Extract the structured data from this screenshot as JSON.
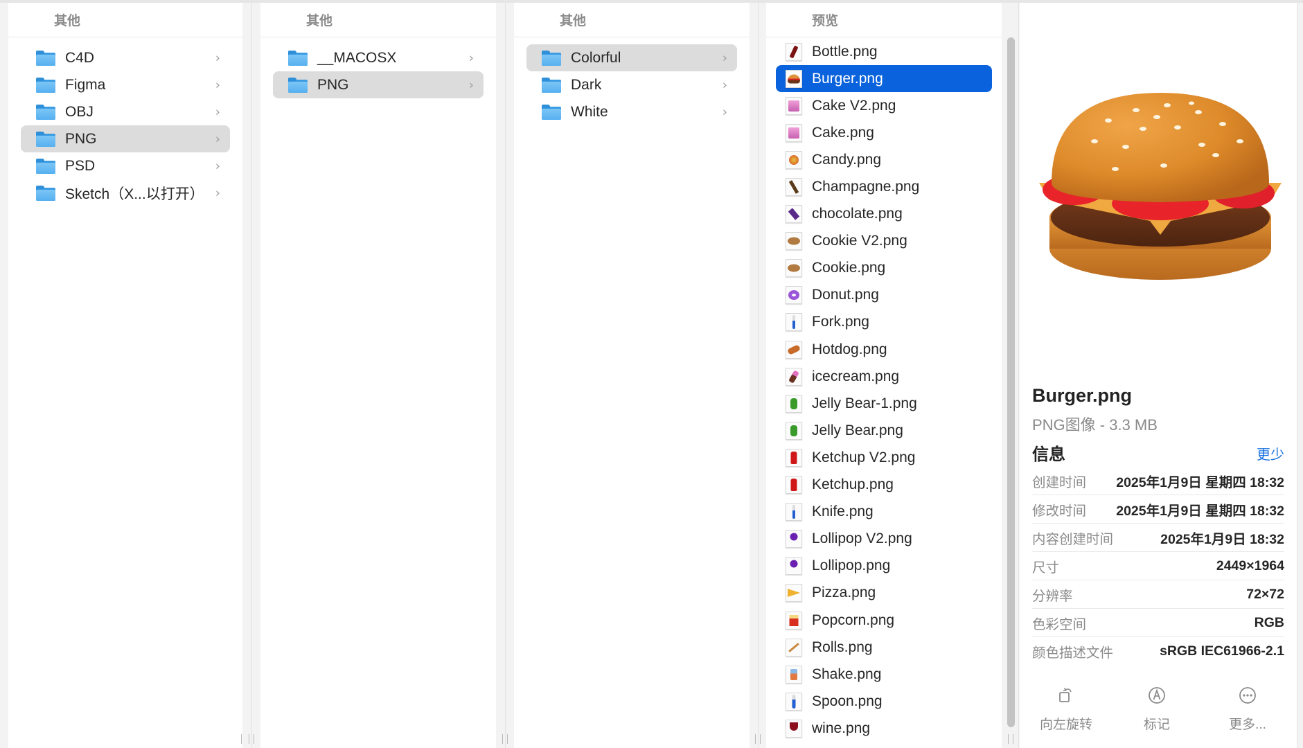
{
  "columns": [
    {
      "header": "其他",
      "items": [
        {
          "label": "C4D",
          "selected": false
        },
        {
          "label": "Figma",
          "selected": false
        },
        {
          "label": "OBJ",
          "selected": false
        },
        {
          "label": "PNG",
          "selected": true
        },
        {
          "label": "PSD",
          "selected": false
        },
        {
          "label": "Sketch（X...以打开）",
          "selected": false
        }
      ]
    },
    {
      "header": "其他",
      "items": [
        {
          "label": "__MACOSX",
          "selected": false
        },
        {
          "label": "PNG",
          "selected": true
        }
      ]
    },
    {
      "header": "其他",
      "items": [
        {
          "label": "Colorful",
          "selected": true
        },
        {
          "label": "Dark",
          "selected": false
        },
        {
          "label": "White",
          "selected": false
        }
      ]
    }
  ],
  "files": {
    "header": "预览",
    "selected_index": 1,
    "items": [
      {
        "name": "Bottle.png",
        "icon": "bottle-icon"
      },
      {
        "name": "Burger.png",
        "icon": "burger-icon"
      },
      {
        "name": "Cake V2.png",
        "icon": "cake-icon"
      },
      {
        "name": "Cake.png",
        "icon": "cake-icon"
      },
      {
        "name": "Candy.png",
        "icon": "candy-icon"
      },
      {
        "name": "Champagne.png",
        "icon": "champagne-icon"
      },
      {
        "name": "chocolate.png",
        "icon": "chocolate-icon"
      },
      {
        "name": "Cookie V2.png",
        "icon": "cookie-icon"
      },
      {
        "name": "Cookie.png",
        "icon": "cookie-icon"
      },
      {
        "name": "Donut.png",
        "icon": "donut-icon"
      },
      {
        "name": "Fork.png",
        "icon": "fork-icon"
      },
      {
        "name": "Hotdog.png",
        "icon": "hotdog-icon"
      },
      {
        "name": "icecream.png",
        "icon": "icecream-icon"
      },
      {
        "name": "Jelly Bear-1.png",
        "icon": "jelly-bear-icon"
      },
      {
        "name": "Jelly Bear.png",
        "icon": "jelly-bear-icon"
      },
      {
        "name": "Ketchup V2.png",
        "icon": "ketchup-icon"
      },
      {
        "name": "Ketchup.png",
        "icon": "ketchup-icon"
      },
      {
        "name": "Knife.png",
        "icon": "knife-icon"
      },
      {
        "name": "Lollipop V2.png",
        "icon": "lollipop-icon"
      },
      {
        "name": "Lollipop.png",
        "icon": "lollipop-icon"
      },
      {
        "name": "Pizza.png",
        "icon": "pizza-icon"
      },
      {
        "name": "Popcorn.png",
        "icon": "popcorn-icon"
      },
      {
        "name": "Rolls.png",
        "icon": "rolls-icon"
      },
      {
        "name": "Shake.png",
        "icon": "shake-icon"
      },
      {
        "name": "Spoon.png",
        "icon": "spoon-icon"
      },
      {
        "name": "wine.png",
        "icon": "wine-icon"
      }
    ]
  },
  "preview": {
    "title": "Burger.png",
    "subtitle": "PNG图像 - 3.3 MB",
    "info_label": "信息",
    "less_label": "更少",
    "metadata": [
      {
        "key": "创建时间",
        "value": "2025年1月9日 星期四 18:32"
      },
      {
        "key": "修改时间",
        "value": "2025年1月9日 星期四 18:32"
      },
      {
        "key": "内容创建时间",
        "value": "2025年1月9日 18:32"
      },
      {
        "key": "尺寸",
        "value": "2449×1964"
      },
      {
        "key": "分辨率",
        "value": "72×72"
      },
      {
        "key": "色彩空间",
        "value": "RGB"
      },
      {
        "key": "颜色描述文件",
        "value": "sRGB IEC61966-2.1"
      }
    ],
    "actions": [
      {
        "label": "向左旋转",
        "icon": "rotate-left-icon"
      },
      {
        "label": "标记",
        "icon": "markup-icon"
      },
      {
        "label": "更多...",
        "icon": "more-icon"
      }
    ]
  },
  "colors": {
    "selection_blue": "#0a62dc",
    "selection_gray": "#dcdcdc",
    "link_blue": "#1a73e0",
    "folder_blue": "#56b0ef"
  }
}
